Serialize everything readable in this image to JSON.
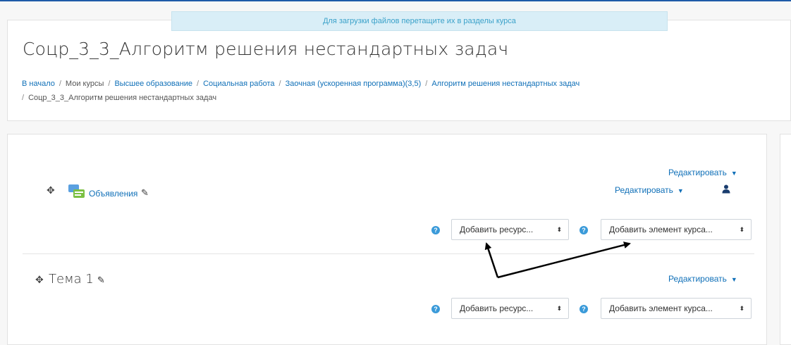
{
  "drop_hint": "Для загрузки файлов перетащите их в разделы курса",
  "course_title": "Соцр_3_3_Алгоритм решения нестандартных задач",
  "breadcrumb": {
    "items": [
      "В начало",
      "Мои курсы",
      "Высшее образование",
      "Социальная работа",
      "Заочная (ускоренная программа)(3,5)",
      "Алгоритм решения нестандартных задач",
      "Соцр_3_3_Алгоритм решения нестандартных задач"
    ],
    "separator": "/"
  },
  "section0": {
    "edit_label": "Редактировать",
    "activity_name": "Объявления",
    "activity_edit_label": "Редактировать",
    "add_resource": "Добавить ресурс...",
    "add_activity": "Добавить элемент курса..."
  },
  "section1": {
    "title": "Тема 1",
    "edit_label": "Редактировать",
    "add_resource": "Добавить ресурс...",
    "add_activity": "Добавить элемент курса..."
  },
  "icons": {
    "move": "move-icon",
    "edit": "pencil-icon",
    "help": "help-icon",
    "forum": "forum-icon",
    "user": "user-icon",
    "caret": "caret-down-icon"
  },
  "colors": {
    "link": "#1070b8",
    "help": "#3a9ad9",
    "drop_hint_bg": "#d9eef7",
    "drop_hint_text": "#3aa1c9"
  }
}
